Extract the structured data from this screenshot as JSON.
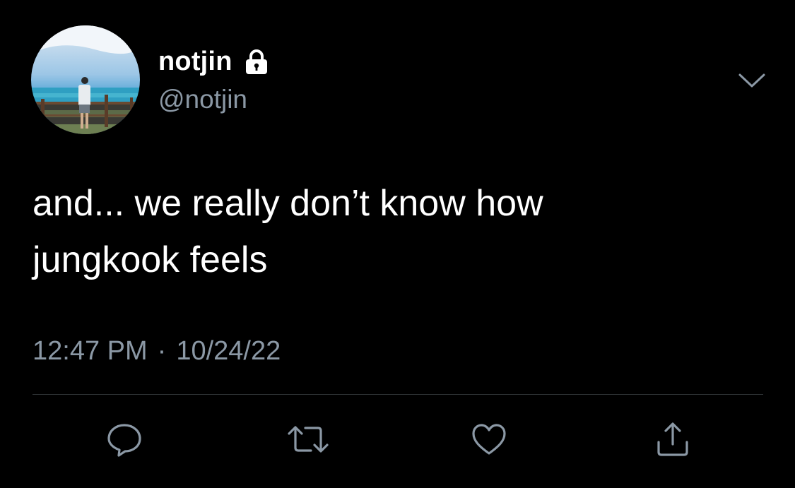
{
  "colors": {
    "background": "#000000",
    "primary_text": "#ffffff",
    "secondary_text": "#8b98a5",
    "divider": "#2f3336"
  },
  "author": {
    "display_name": "notjin",
    "handle": "@notjin",
    "protected": true,
    "avatar_icon": "profile-photo-beach"
  },
  "tweet": {
    "text": "and... we really don’t know how\njungkook feels",
    "time": "12:47 PM",
    "separator": "·",
    "date": "10/24/22"
  },
  "actions": [
    {
      "name": "reply",
      "icon": "reply-icon"
    },
    {
      "name": "retweet",
      "icon": "retweet-icon"
    },
    {
      "name": "like",
      "icon": "heart-icon"
    },
    {
      "name": "share",
      "icon": "share-icon"
    }
  ]
}
